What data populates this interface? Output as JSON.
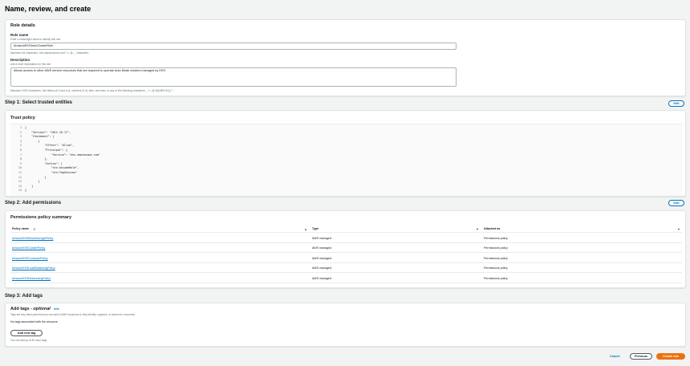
{
  "page": {
    "title": "Name, review, and create"
  },
  "role_details": {
    "title": "Role details",
    "role_name_label": "Role name",
    "role_name_desc": "Enter a meaningful name to identify this role.",
    "role_name_value": "AmazonEKSAutoClusterRole",
    "role_name_hint": "Maximum 64 characters. Use alphanumeric and '+=,.@-_' characters.",
    "description_label": "Description",
    "description_desc": "Add a short explanation for this role.",
    "description_value": "Allows access to other AWS service resources that are required to operate Auto Mode clusters managed by EKS.",
    "description_hint": "Maximum 1000 characters. Use letters (A-Z and a-z), numbers (0-9), tabs, new lines, or any of the following characters: _+=,.@-/\\[\\]!#$%^&*();'\"~"
  },
  "step1": {
    "title": "Step 1: Select trusted entities",
    "edit_label": "Edit",
    "trust_policy_title": "Trust policy",
    "lines": [
      {
        "n": "1",
        "t": "{"
      },
      {
        "n": "2",
        "t": "    \"Version\": \"2012-10-17\","
      },
      {
        "n": "3",
        "t": "    \"Statement\": ["
      },
      {
        "n": "4",
        "t": "        {"
      },
      {
        "n": "5",
        "t": "            \"Effect\": \"Allow\","
      },
      {
        "n": "6",
        "t": "            \"Principal\": {"
      },
      {
        "n": "7",
        "t": "                \"Service\": \"eks.amazonaws.com\""
      },
      {
        "n": "8",
        "t": "            },"
      },
      {
        "n": "9",
        "t": "            \"Action\": ["
      },
      {
        "n": "10",
        "t": "                \"sts:AssumeRole\","
      },
      {
        "n": "11",
        "t": "                \"sts:TagSession\""
      },
      {
        "n": "12",
        "t": "            ]"
      },
      {
        "n": "13",
        "t": "        }"
      },
      {
        "n": "14",
        "t": "    ]"
      },
      {
        "n": "15",
        "t": "}"
      }
    ]
  },
  "step2": {
    "title": "Step 2: Add permissions",
    "edit_label": "Edit",
    "summary_title": "Permissions policy summary",
    "columns": [
      "Policy name",
      "Type",
      "Attached as"
    ],
    "rows": [
      {
        "name": "AmazonEKSBlockStoragePolicy",
        "type": "AWS managed",
        "attached": "Permissions policy"
      },
      {
        "name": "AmazonEKSClusterPolicy",
        "type": "AWS managed",
        "attached": "Permissions policy"
      },
      {
        "name": "AmazonEKSComputePolicy",
        "type": "AWS managed",
        "attached": "Permissions policy"
      },
      {
        "name": "AmazonEKSLoadBalancingPolicy",
        "type": "AWS managed",
        "attached": "Permissions policy"
      },
      {
        "name": "AmazonEKSNetworkingPolicy",
        "type": "AWS managed",
        "attached": "Permissions policy"
      }
    ]
  },
  "step3": {
    "title": "Step 3: Add tags",
    "add_tags_title": "Add tags - ",
    "add_tags_optional": "optional",
    "info": "Info",
    "add_tags_desc": "Tags are key-value pairs that you can add to AWS resources to help identify, organize, or search for resources.",
    "no_tags": "No tags associated with the resource.",
    "add_new_tag": "Add new tag",
    "tag_limit": "You can add up to 50 more tags."
  },
  "footer": {
    "cancel": "Cancel",
    "previous": "Previous",
    "create": "Create role"
  }
}
